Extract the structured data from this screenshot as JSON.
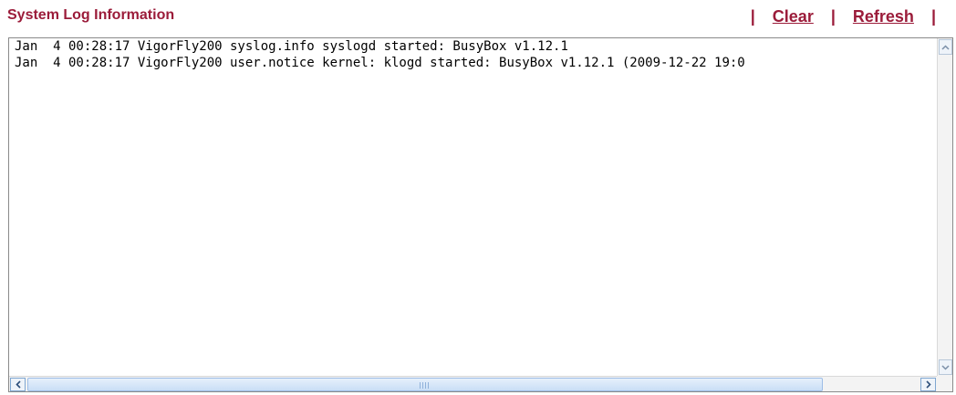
{
  "header": {
    "title": "System Log Information",
    "links": [
      {
        "label": "Clear"
      },
      {
        "label": "Refresh"
      }
    ],
    "separator": "|"
  },
  "log": {
    "lines": [
      "Jan  4 00:28:17 VigorFly200 syslog.info syslogd started: BusyBox v1.12.1",
      "Jan  4 00:28:17 VigorFly200 user.notice kernel: klogd started: BusyBox v1.12.1 (2009-12-22 19:0"
    ]
  },
  "scrollbars": {
    "vertical": {
      "up_icon": "chevron-up",
      "down_icon": "chevron-down"
    },
    "horizontal": {
      "left_icon": "chevron-left",
      "right_icon": "chevron-right"
    }
  }
}
